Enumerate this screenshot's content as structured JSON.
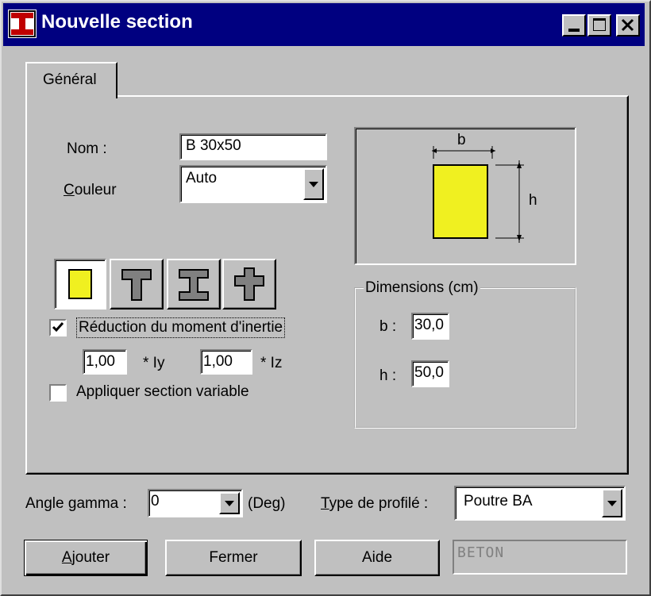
{
  "window": {
    "title": "Nouvelle section",
    "app_icon": "i-beam-icon",
    "controls": {
      "minimize": "minimize-icon",
      "maximize": "maximize-icon",
      "close": "close-icon"
    }
  },
  "tabs": [
    {
      "label": "Général",
      "active": true
    }
  ],
  "form": {
    "nom_label": "Nom :",
    "nom_value": "B 30x50",
    "couleur_label_first": "C",
    "couleur_label_rest": "ouleur",
    "couleur_value": "Auto"
  },
  "section_types": [
    {
      "name": "rectangle",
      "icon": "rectangle-section-icon",
      "selected": true
    },
    {
      "name": "t-section",
      "icon": "t-section-icon",
      "selected": false
    },
    {
      "name": "i-section",
      "icon": "i-section-icon",
      "selected": false
    },
    {
      "name": "cross-section",
      "icon": "cross-section-icon",
      "selected": false
    }
  ],
  "inertia": {
    "label": "Réduction du moment d'inertie",
    "checked": true,
    "iy_value": "1,00",
    "iy_suffix": "* Iy",
    "iz_value": "1,00",
    "iz_suffix": "* Iz"
  },
  "variable": {
    "label": "Appliquer section variable",
    "checked": false
  },
  "diagram": {
    "b_label": "b",
    "h_label": "h",
    "fill_color": "#f0f020"
  },
  "dimensions": {
    "group_label": "Dimensions (cm)",
    "b_label": "b :",
    "b_value": "30,0",
    "h_label": "h :",
    "h_value": "50,0"
  },
  "bottom": {
    "angle_label_pre": "Angle ",
    "angle_label_u": "g",
    "angle_label_post": "amma :",
    "angle_value": "0",
    "angle_unit": "(Deg)",
    "type_label_u": "T",
    "type_label_rest": "ype de profilé :",
    "type_value": "Poutre BA"
  },
  "buttons": {
    "ajouter_u": "A",
    "ajouter_rest": "jouter",
    "fermer": "Fermer",
    "aide": "Aide",
    "material": "BETON"
  }
}
